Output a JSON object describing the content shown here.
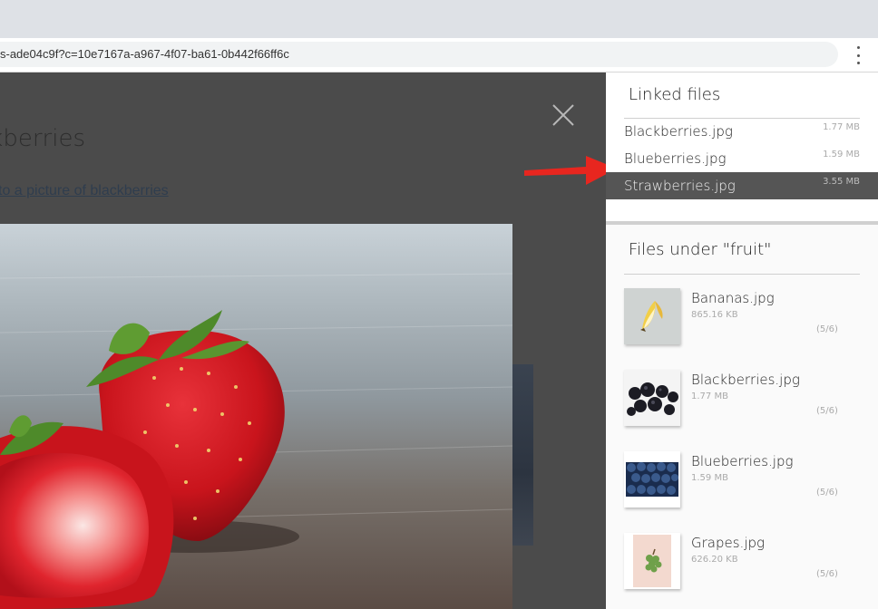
{
  "browser": {
    "url": "s-ade04c9f?c=10e7167a-a967-4f07-ba61-0b442f66ff6c"
  },
  "page": {
    "title": "ckberries",
    "link_text": "to a picture of blackberries"
  },
  "sidebar": {
    "linked_title": "Linked files",
    "linked_files": [
      {
        "name": "Blackberries.jpg",
        "size": "1.77 MB"
      },
      {
        "name": "Blueberries.jpg",
        "size": "1.59 MB"
      },
      {
        "name": "Strawberries.jpg",
        "size": "3.55 MB",
        "active": true
      }
    ],
    "fruit_title": "Files under \"fruit\"",
    "fruit_files": [
      {
        "name": "Bananas.jpg",
        "size": "865.16 KB",
        "count": "(5/6)",
        "icon": "banana-thumbnail"
      },
      {
        "name": "Blackberries.jpg",
        "size": "1.77 MB",
        "count": "(5/6)",
        "icon": "blackberries-thumbnail"
      },
      {
        "name": "Blueberries.jpg",
        "size": "1.59 MB",
        "count": "(5/6)",
        "icon": "blueberries-thumbnail"
      },
      {
        "name": "Grapes.jpg",
        "size": "626.20 KB",
        "count": "(5/6)",
        "icon": "grapes-thumbnail"
      }
    ]
  },
  "colors": {
    "overlay": "#4b4b4b",
    "active_item": "#555555",
    "annotation_arrow": "#e8261f"
  }
}
